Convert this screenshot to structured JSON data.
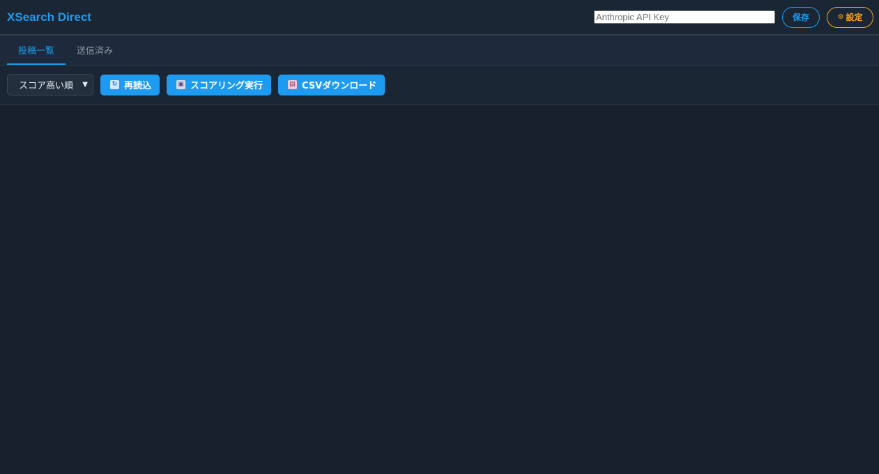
{
  "header": {
    "brand": "XSearch Direct",
    "api_key_placeholder": "Anthropic API Key",
    "save_label": "保存",
    "settings_icon": "gear-icon",
    "settings_label": "設定"
  },
  "tabs": [
    {
      "label": "投稿一覧",
      "active": true
    },
    {
      "label": "送信済み",
      "active": false
    }
  ],
  "toolbar": {
    "sort_selected": "スコア高い順",
    "reload_icon": "reload-icon",
    "reload_label": "再読込",
    "scoring_icon": "robot-icon",
    "scoring_label": "スコアリング実行",
    "csv_icon": "box-icon",
    "csv_label": "CSVダウンロード"
  },
  "colors": {
    "accent": "#1d9bf0",
    "settings": "#f5a623",
    "background": "#17202b"
  }
}
